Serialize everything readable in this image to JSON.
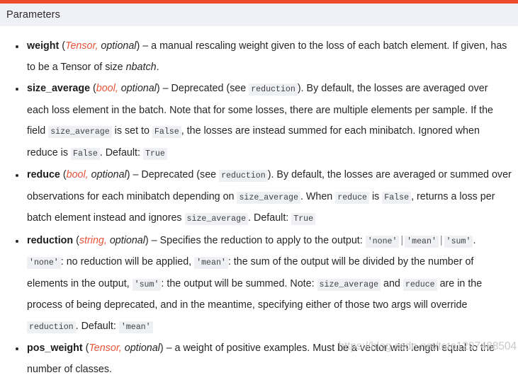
{
  "accent_color": "#ee4c2c",
  "header_bg": "#f0f1f6",
  "type_color": "#e8543a",
  "code_bg": "#eef0f3",
  "section": {
    "title": "Parameters"
  },
  "params": [
    {
      "name": "weight",
      "type": "Tensor",
      "optional": "optional",
      "paren_open": "(",
      "comma": ",",
      "paren_close": ")",
      "dash": " – ",
      "body": [
        {
          "kind": "text",
          "value": "a manual rescaling weight given to the loss of each batch element. If given, has to be a Tensor of size "
        },
        {
          "kind": "em",
          "value": "nbatch"
        },
        {
          "kind": "text",
          "value": "."
        }
      ]
    },
    {
      "name": "size_average",
      "type": "bool",
      "optional": "optional",
      "paren_open": "(",
      "comma": ",",
      "paren_close": ")",
      "dash": " – ",
      "body": [
        {
          "kind": "text",
          "value": "Deprecated (see "
        },
        {
          "kind": "code",
          "value": "reduction"
        },
        {
          "kind": "text",
          "value": "). By default, the losses are averaged over each loss element in the batch. Note that for some losses, there are multiple elements per sample. If the field "
        },
        {
          "kind": "code",
          "value": "size_average"
        },
        {
          "kind": "text",
          "value": " is set to "
        },
        {
          "kind": "code",
          "value": "False"
        },
        {
          "kind": "text",
          "value": ", the losses are instead summed for each minibatch. Ignored when reduce is "
        },
        {
          "kind": "code",
          "value": "False"
        },
        {
          "kind": "text",
          "value": ". Default: "
        },
        {
          "kind": "code",
          "value": "True"
        }
      ]
    },
    {
      "name": "reduce",
      "type": "bool",
      "optional": "optional",
      "paren_open": "(",
      "comma": ",",
      "paren_close": ")",
      "dash": " – ",
      "body": [
        {
          "kind": "text",
          "value": "Deprecated (see "
        },
        {
          "kind": "code",
          "value": "reduction"
        },
        {
          "kind": "text",
          "value": "). By default, the losses are averaged or summed over observations for each minibatch depending on "
        },
        {
          "kind": "code",
          "value": "size_average"
        },
        {
          "kind": "text",
          "value": ". When "
        },
        {
          "kind": "code",
          "value": "reduce"
        },
        {
          "kind": "text",
          "value": " is "
        },
        {
          "kind": "code",
          "value": "False"
        },
        {
          "kind": "text",
          "value": ", returns a loss per batch element instead and ignores "
        },
        {
          "kind": "code",
          "value": "size_average"
        },
        {
          "kind": "text",
          "value": ". Default: "
        },
        {
          "kind": "code",
          "value": "True"
        }
      ]
    },
    {
      "name": "reduction",
      "type": "string",
      "optional": "optional",
      "paren_open": "(",
      "comma": ",",
      "paren_close": ")",
      "dash": " – ",
      "body": [
        {
          "kind": "text",
          "value": "Specifies the reduction to apply to the output: "
        },
        {
          "kind": "code",
          "value": "'none'"
        },
        {
          "kind": "pipe",
          "value": "|"
        },
        {
          "kind": "code",
          "value": "'mean'"
        },
        {
          "kind": "pipe",
          "value": "|"
        },
        {
          "kind": "code",
          "value": "'sum'"
        },
        {
          "kind": "text",
          "value": ". "
        },
        {
          "kind": "code",
          "value": "'none'"
        },
        {
          "kind": "text",
          "value": ": no reduction will be applied, "
        },
        {
          "kind": "code",
          "value": "'mean'"
        },
        {
          "kind": "text",
          "value": ": the sum of the output will be divided by the number of elements in the output, "
        },
        {
          "kind": "code",
          "value": "'sum'"
        },
        {
          "kind": "text",
          "value": ": the output will be summed. Note: "
        },
        {
          "kind": "code",
          "value": "size_average"
        },
        {
          "kind": "text",
          "value": " and "
        },
        {
          "kind": "code",
          "value": "reduce"
        },
        {
          "kind": "text",
          "value": " are in the process of being deprecated, and in the meantime, specifying either of those two args will override "
        },
        {
          "kind": "code",
          "value": "reduction"
        },
        {
          "kind": "text",
          "value": ". Default: "
        },
        {
          "kind": "code",
          "value": "'mean'"
        }
      ]
    },
    {
      "name": "pos_weight",
      "type": "Tensor",
      "optional": "optional",
      "paren_open": "(",
      "comma": ",",
      "paren_close": ")",
      "dash": " – ",
      "body": [
        {
          "kind": "text",
          "value": "a weight of positive examples. Must be a vector with length equal to the number of classes."
        }
      ]
    }
  ],
  "watermark": {
    "text": "https://blog.csdn.net/toto1297488504"
  }
}
